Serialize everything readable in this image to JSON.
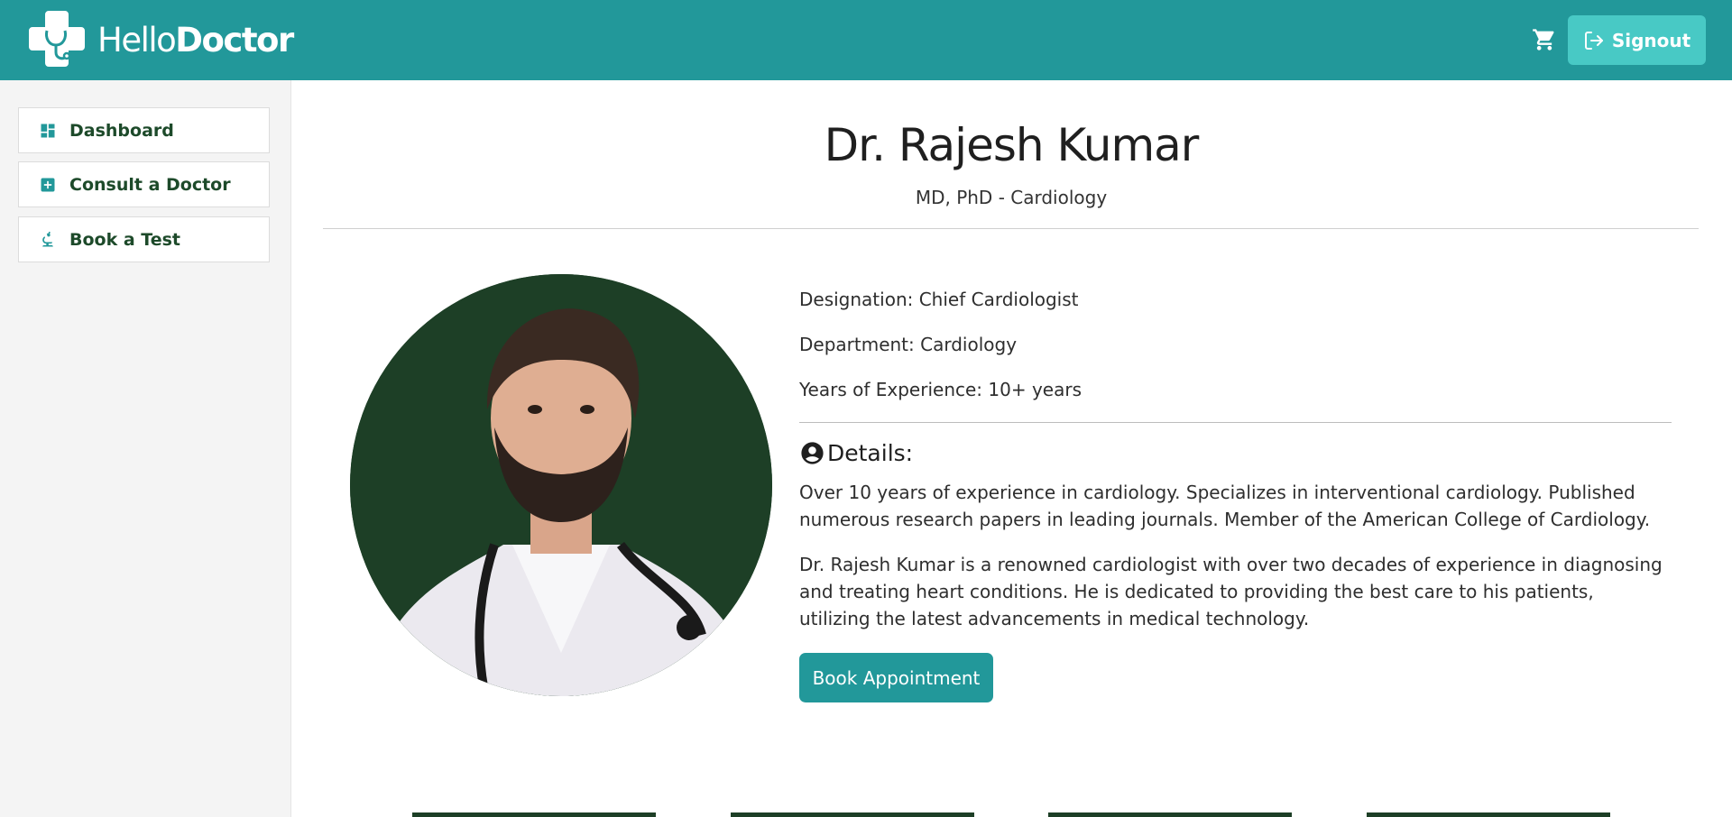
{
  "header": {
    "logo_light": "Hello",
    "logo_bold": "Doctor",
    "signout_label": "Signout"
  },
  "sidebar": {
    "items": [
      {
        "label": "Dashboard",
        "icon": "dashboard-icon"
      },
      {
        "label": "Consult a Doctor",
        "icon": "medical-plus-icon"
      },
      {
        "label": "Book a Test",
        "icon": "microscope-icon"
      }
    ]
  },
  "doctor": {
    "name": "Dr. Rajesh Kumar",
    "qualifications": "MD, PhD - Cardiology",
    "designation": "Designation: Chief Cardiologist",
    "department": "Department: Cardiology",
    "experience": "Years of Experience: 10+ years",
    "details_heading": "Details:",
    "summary": "Over 10 years of experience in cardiology. Specializes in interventional cardiology. Published numerous research papers in leading journals. Member of the American College of Cardiology.",
    "bio": "Dr. Rajesh Kumar is a renowned cardiologist with over two decades of experience in diagnosing and treating heart conditions. He is dedicated to providing the best care to his patients, utilizing the latest advancements in medical technology.",
    "book_label": "Book Appointment"
  },
  "colors": {
    "brand": "#22989a",
    "signout_bg": "#48c9c5",
    "photo_bg": "#1d3f26",
    "sidebar_text": "#1d4a2a"
  }
}
